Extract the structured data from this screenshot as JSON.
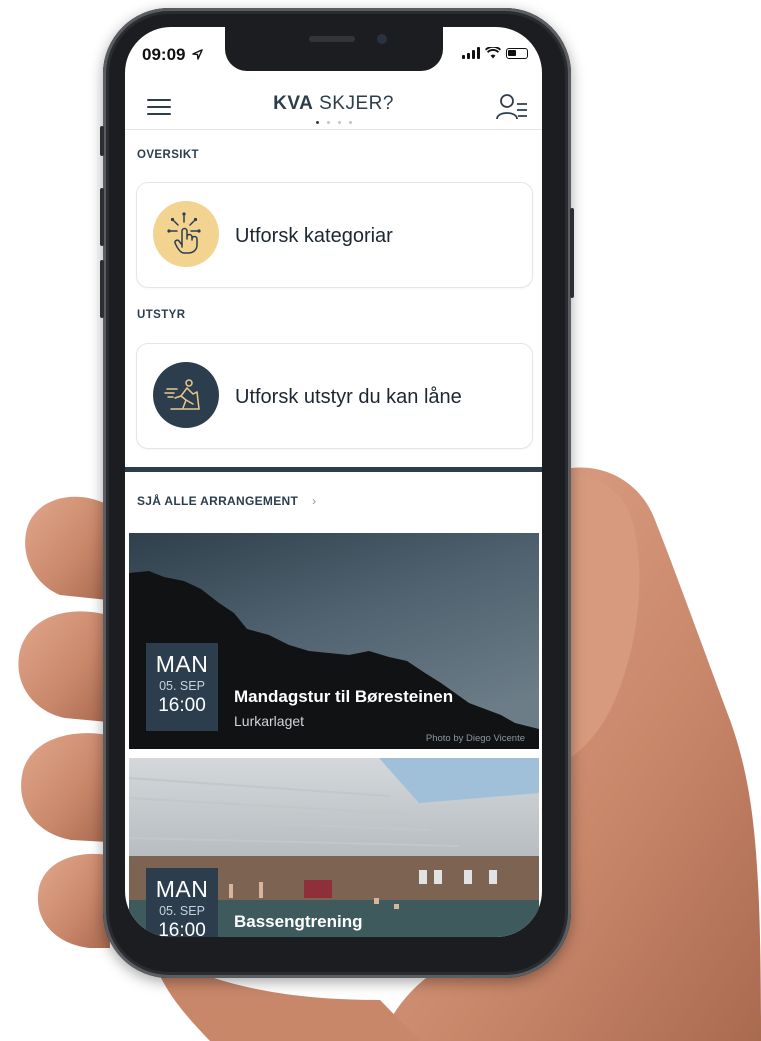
{
  "status_bar": {
    "time": "09:09"
  },
  "header": {
    "title_bold": "KVA",
    "title_rest": "SKJER?",
    "page_count": 4,
    "active_page": 1
  },
  "sections": {
    "overview": {
      "label": "OVERSIKT",
      "card_label": "Utforsk kategoriar",
      "icon": "tap-hand-icon",
      "icon_bg": "#f3d390"
    },
    "equipment": {
      "label": "UTSTYR",
      "card_label": "Utforsk utstyr du kan låne",
      "icon": "skier-icon",
      "icon_bg": "#2c3e4e"
    }
  },
  "events_link": {
    "label": "SJÅ ALLE ARRANGEMENT",
    "chevron": "›"
  },
  "events": [
    {
      "day": "MAN",
      "date": "05. SEP",
      "time": "16:00",
      "title": "Mandagstur til Børesteinen",
      "organizer": "Lurkarlaget",
      "photo_credit": "Photo by Diego Vicente"
    },
    {
      "day": "MAN",
      "date": "05. SEP",
      "time": "16:00",
      "title": "Bassengtrening"
    }
  ],
  "colors": {
    "primary": "#2c3e4e",
    "accent": "#f3d390"
  }
}
